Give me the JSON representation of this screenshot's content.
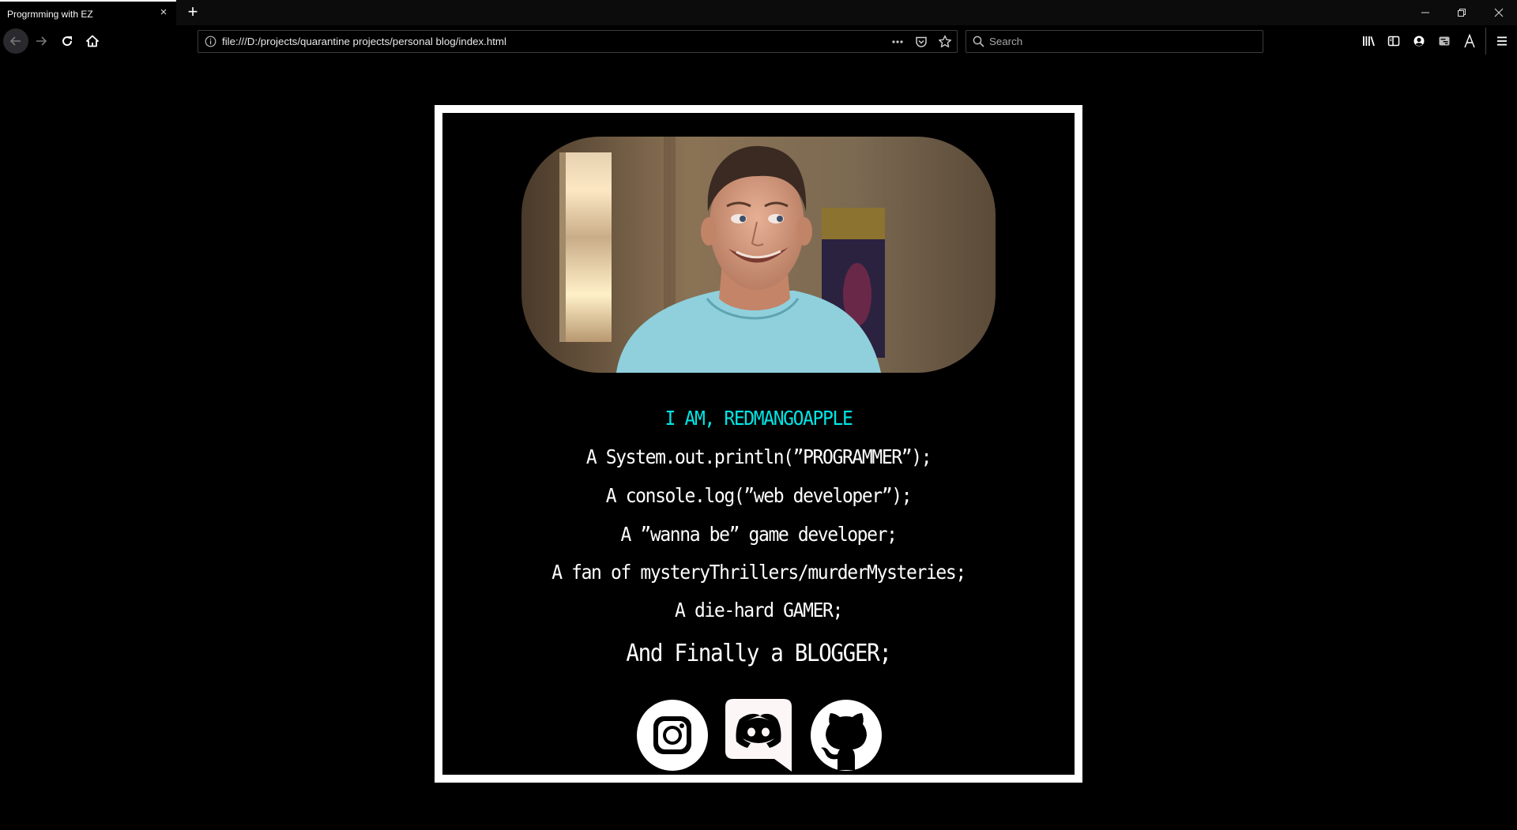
{
  "browser": {
    "tab": {
      "title": "Progrmming with EZ",
      "close_label": "×"
    },
    "new_tab_label": "+",
    "window_controls": {
      "minimize": "minimize-icon",
      "restore": "restore-icon",
      "close": "close-icon"
    },
    "nav": {
      "back": "back-arrow-icon",
      "forward": "forward-arrow-icon",
      "reload": "reload-icon",
      "home": "home-icon"
    },
    "url": "file:///D:/projects/quarantine projects/personal blog/index.html",
    "url_actions": [
      "more-icon",
      "pocket-icon",
      "bookmark-star-icon"
    ],
    "search": {
      "placeholder": "Search",
      "value": ""
    },
    "toolbar": [
      "library-icon",
      "sidebar-icon",
      "account-icon",
      "reader-icon",
      "font-icon",
      "hamburger-menu-icon"
    ]
  },
  "page": {
    "photo_alt": "Profile photo of a grinning man in a light blue t-shirt",
    "heading": "I AM, REDMANGOAPPLE",
    "heading_color": "#00e5e5",
    "lines": [
      "A System.out.println(”PROGRAMMER”);",
      "A console.log(”web developer”);",
      "A ”wanna be” game developer;",
      "A fan of mysteryThrillers/murderMysteries;",
      "A die-hard GAMER;"
    ],
    "final_line": "And Finally a BLOGGER;",
    "socials": [
      {
        "name": "instagram",
        "icon": "instagram-icon"
      },
      {
        "name": "discord",
        "icon": "discord-icon"
      },
      {
        "name": "github",
        "icon": "github-icon"
      }
    ]
  }
}
